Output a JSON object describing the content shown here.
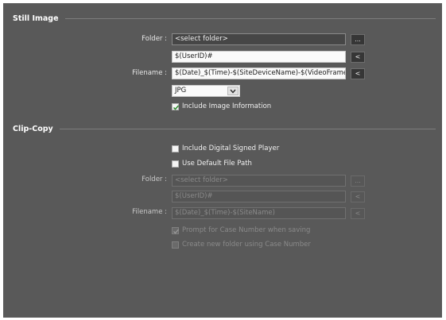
{
  "still_image": {
    "title": "Still Image",
    "folder_label": "Folder :",
    "folder_value": "<select folder>",
    "folder_button": "...",
    "subfolder_value": "$(UserID)#",
    "subfolder_button": "<",
    "filename_label": "Filename :",
    "filename_value": "$(Date)_$(Time)-$(SiteDeviceName)-$(VideoFrameSpot)",
    "filename_button": "<",
    "format_value": "JPG",
    "include_info_label": "Include Image Information",
    "include_info_checked": true
  },
  "clip_copy": {
    "title": "Clip-Copy",
    "signed_player_label": "Include Digital Signed Player",
    "signed_player_checked": false,
    "default_path_label": "Use Default File Path",
    "default_path_checked": false,
    "folder_label": "Folder :",
    "folder_value": "<select folder>",
    "folder_button": "...",
    "subfolder_value": "$(UserID)#",
    "subfolder_button": "<",
    "filename_label": "Filename :",
    "filename_value": "$(Date)_$(Time)-$(SiteName)",
    "filename_button": "<",
    "prompt_case_label": "Prompt for Case Number when saving",
    "prompt_case_checked": true,
    "create_folder_label": "Create new folder using Case Number",
    "create_folder_checked": false
  },
  "colors": {
    "panel_bg": "#595959",
    "text": "#e6e6e6",
    "disabled_text": "#8a8a8a"
  }
}
